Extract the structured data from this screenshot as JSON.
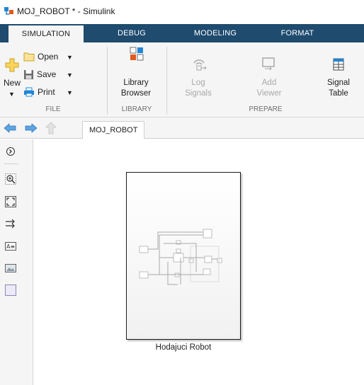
{
  "window": {
    "title": "MOJ_ROBOT * - Simulink"
  },
  "tabs": [
    {
      "label": "SIMULATION",
      "active": true
    },
    {
      "label": "DEBUG",
      "active": false
    },
    {
      "label": "MODELING",
      "active": false
    },
    {
      "label": "FORMAT",
      "active": false
    }
  ],
  "ribbon": {
    "file": {
      "group_label": "FILE",
      "new_label": "New",
      "open_label": "Open",
      "save_label": "Save",
      "print_label": "Print"
    },
    "library": {
      "group_label": "LIBRARY",
      "library_browser_line1": "Library",
      "library_browser_line2": "Browser"
    },
    "prepare": {
      "group_label": "PREPARE",
      "log_signals_line1": "Log",
      "log_signals_line2": "Signals",
      "add_viewer_line1": "Add",
      "add_viewer_line2": "Viewer",
      "signal_table_line1": "Signal",
      "signal_table_line2": "Table"
    }
  },
  "address_bar": {
    "model_tab": "MOJ_ROBOT"
  },
  "canvas": {
    "subsystem_label": "Hodajuci Robot"
  },
  "colors": {
    "tab_strip": "#1e4b6e",
    "ribbon_bg": "#f5f5f5",
    "accent_blue": "#1f86d6"
  },
  "icons": {
    "app": "simulink-icon",
    "new": "plus-icon",
    "open": "folder-icon",
    "save": "floppy-icon",
    "print": "printer-icon",
    "library_browser": "library-browser-icon",
    "log_signals": "log-signals-icon",
    "add_viewer": "add-viewer-icon",
    "signal_table": "signal-table-icon",
    "back": "arrow-left-icon",
    "forward": "arrow-right-icon",
    "up": "arrow-up-icon"
  }
}
